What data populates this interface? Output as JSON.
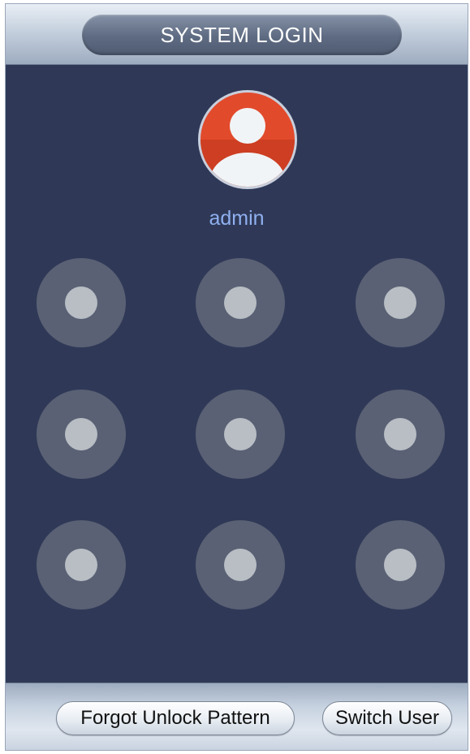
{
  "window": {
    "title": "SYSTEM LOGIN"
  },
  "user": {
    "name": "admin",
    "avatar_icon": "user-avatar-icon",
    "avatar_color": "#e24a2c"
  },
  "pattern": {
    "rows": 3,
    "cols": 3,
    "dot_color": "#5a6174",
    "dot_center_color": "#b8bec4"
  },
  "buttons": {
    "forgot_label": "Forgot Unlock Pattern",
    "switch_label": "Switch User"
  },
  "colors": {
    "background": "#2f3957",
    "username_text": "#8fb0f0"
  }
}
